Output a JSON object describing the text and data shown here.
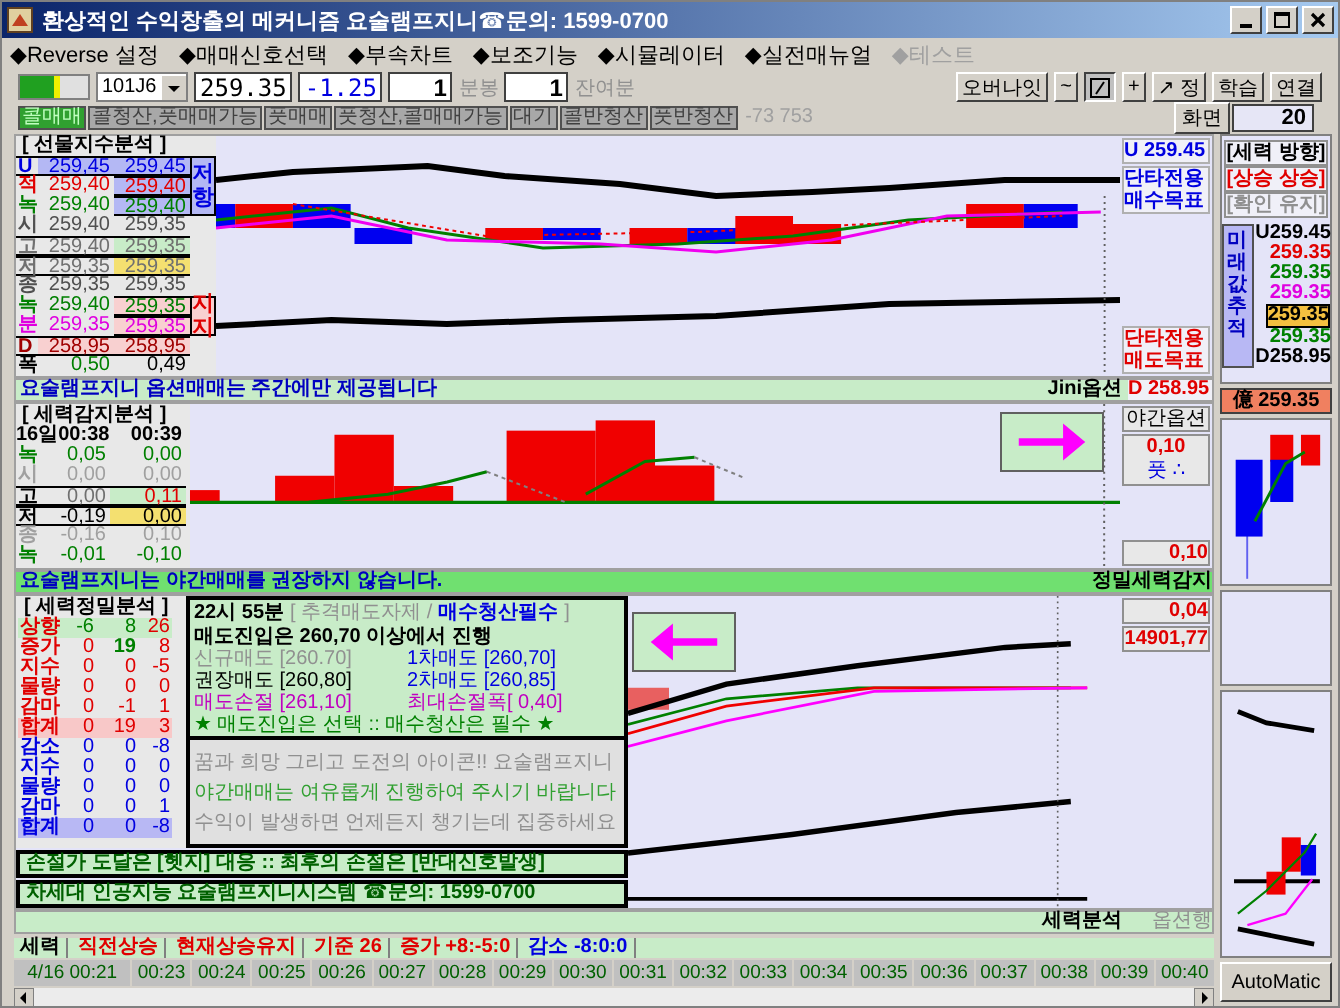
{
  "window": {
    "title": "환상적인 수익창출의 메커니즘 요술램프지니☎문의: 1599-0700"
  },
  "menu": [
    {
      "label": "◆Reverse 설정",
      "disabled": false
    },
    {
      "label": "◆매매신호선택",
      "disabled": false
    },
    {
      "label": "◆부속차트",
      "disabled": false
    },
    {
      "label": "◆보조기능",
      "disabled": false
    },
    {
      "label": "◆시뮬레이터",
      "disabled": false
    },
    {
      "label": "◆실전매뉴얼",
      "disabled": false
    },
    {
      "label": "◆테스트",
      "disabled": true
    }
  ],
  "toolbar": {
    "meter": {
      "level": 0.6
    },
    "symbol": "101J6",
    "price": "259.35",
    "change": "-1.25",
    "interval": "1",
    "interval_label": "분봉",
    "remaining": "1",
    "remaining_label": "잔여분",
    "tools": [
      {
        "kind": "text",
        "label": "오버나잇",
        "selected": false
      },
      {
        "kind": "text",
        "label": "~",
        "selected": false
      },
      {
        "kind": "line",
        "selected": true
      },
      {
        "kind": "text",
        "label": "+",
        "selected": false
      },
      {
        "kind": "text",
        "label": "↗ 정",
        "selected": false
      },
      {
        "kind": "text",
        "label": "학습",
        "selected": false
      },
      {
        "kind": "text",
        "label": "연결",
        "selected": false
      }
    ],
    "screen_label": "화면",
    "screen_value": "20"
  },
  "signals": [
    {
      "label": "콜매매",
      "selected": true
    },
    {
      "label": "콜청산,풋매매가능",
      "selected": false
    },
    {
      "label": "풋매매",
      "selected": false
    },
    {
      "label": "풋청산,콜매매가능",
      "selected": false
    },
    {
      "label": "대기",
      "selected": false
    },
    {
      "label": "콜반청산",
      "selected": false
    },
    {
      "label": "풋반청산",
      "selected": false
    }
  ],
  "signal_note": "-73 753",
  "futures_panel": {
    "title": "[ 선물지수분석 ]",
    "resist_label": "저항",
    "support_label": "지지",
    "rows": [
      {
        "label": "U",
        "values": [
          "259,45",
          "259,45"
        ],
        "color": "#0000e0",
        "kind": "upper"
      },
      {
        "label": "적",
        "values": [
          "259,40",
          "259,40"
        ],
        "color": "#e00000",
        "kind": "resist"
      },
      {
        "label": "녹",
        "values": [
          "259,40",
          "259,40"
        ],
        "color": "#008000",
        "kind": "resist"
      },
      {
        "label": "시",
        "values": [
          "259,40",
          "259,35"
        ],
        "color": "#505050",
        "kind": "plain"
      },
      {
        "label": "고",
        "values": [
          "259,40",
          "259,35"
        ],
        "color": "#707070",
        "kind": "high"
      },
      {
        "label": "저",
        "values": [
          "259,35",
          "259,35"
        ],
        "color": "#707070",
        "kind": "low"
      },
      {
        "label": "종",
        "values": [
          "259,35",
          "259,35"
        ],
        "color": "#505050",
        "kind": "plain"
      },
      {
        "label": "녹",
        "values": [
          "259,40",
          "259,35"
        ],
        "color": "#008000",
        "kind": "support"
      },
      {
        "label": "분",
        "values": [
          "259,35",
          "259,35"
        ],
        "color": "#e000e0",
        "kind": "support"
      },
      {
        "label": "D",
        "values": [
          "258,95",
          "258,95"
        ],
        "color": "#a00000",
        "kind": "lower"
      },
      {
        "label": "폭",
        "values": [
          "0,50",
          "0,49"
        ],
        "color": "#008000",
        "kind": "width"
      }
    ],
    "chart_labels": {
      "top_value": "U 259.45",
      "buy_target": [
        "단타전용",
        "매수목표"
      ],
      "sell_target": [
        "단타전용",
        "매도목표"
      ]
    },
    "footer": "요술램프지니 옵션매매는 주간에만 제공됩니다",
    "footer_tag": "Jini옵션",
    "footer_value": "D 258.95"
  },
  "detect_panel": {
    "title": "[ 세력감지분석 ]",
    "header": [
      "16일00:38",
      "00:39"
    ],
    "rows": [
      {
        "label": "녹",
        "values": [
          "0,05",
          "0,00"
        ],
        "color": "#008000",
        "kind": "plain"
      },
      {
        "label": "시",
        "values": [
          "0,00",
          "0,00"
        ],
        "color": "#a0a0a0",
        "kind": "plain"
      },
      {
        "label": "고",
        "values": [
          "0,00",
          "0,11"
        ],
        "color": "#707070",
        "kind": "high"
      },
      {
        "label": "저",
        "values": [
          "-0,19",
          "0,00"
        ],
        "color": "#000000",
        "kind": "low"
      },
      {
        "label": "종",
        "values": [
          "-0,16",
          "0,10"
        ],
        "color": "#a0a0a0",
        "kind": "plain"
      },
      {
        "label": "녹",
        "values": [
          "-0,01",
          "-0,10"
        ],
        "color": "#008000",
        "kind": "plain"
      }
    ],
    "night_label": "야간옵션",
    "night_value": "0,10",
    "put_label": "풋 ∴",
    "bottom_value": "0,10",
    "footer": "요술램프지니는 야간매매를 권장하지 않습니다.",
    "footer_tag": "정밀세력감지"
  },
  "precision_panel": {
    "title": "[ 세력정밀분석 ]",
    "rows": [
      {
        "label": "상향",
        "values": [
          "-6",
          "8",
          "26"
        ],
        "kind": "head"
      },
      {
        "label": "증가",
        "values": [
          "0",
          "19",
          "8"
        ],
        "kind": "peak"
      },
      {
        "label": "지수",
        "values": [
          "0",
          "0",
          "-5"
        ],
        "kind": "up"
      },
      {
        "label": "물량",
        "values": [
          "0",
          "0",
          "0"
        ],
        "kind": "up"
      },
      {
        "label": "감마",
        "values": [
          "0",
          "-1",
          "1"
        ],
        "kind": "up"
      },
      {
        "label": "합계",
        "values": [
          "0",
          "19",
          "3"
        ],
        "kind": "up-total"
      },
      {
        "label": "감소",
        "values": [
          "0",
          "0",
          "-8"
        ],
        "kind": "down"
      },
      {
        "label": "지수",
        "values": [
          "0",
          "0",
          "0"
        ],
        "kind": "down"
      },
      {
        "label": "물량",
        "values": [
          "0",
          "0",
          "0"
        ],
        "kind": "down"
      },
      {
        "label": "감마",
        "values": [
          "0",
          "0",
          "1"
        ],
        "kind": "down"
      },
      {
        "label": "합계",
        "values": [
          "0",
          "0",
          "-8"
        ],
        "kind": "down-total"
      }
    ],
    "message": {
      "time": "22시 55분",
      "advice": "[ 추격매도자제 /",
      "advice_strong": "매수청산필수",
      "advice_end": "]",
      "entry": "매도진입은 260,70 이상에서 진행",
      "levels": [
        {
          "text": "신규매도 [260.70]",
          "color": "#909090"
        },
        {
          "text": "1차매도 [260,70]",
          "color": "#0000e0"
        },
        {
          "text": "권장매도 [260,80]",
          "color": "#000000"
        },
        {
          "text": "2차매도 [260,85]",
          "color": "#0000e0"
        },
        {
          "text": "매도손절 [261,10]",
          "color": "#c000c0"
        },
        {
          "text": "최대손절폭[ 0,40]",
          "color": "#c000c0"
        }
      ],
      "rule": "★ 매도진입은 선택 :: 매수청산은 필수 ★",
      "notes": [
        {
          "text": "꿈과 희망 그리고 도전의 아이콘!! 요술램프지니",
          "color": "#909090"
        },
        {
          "text": "야간매매는 여유롭게 진행하여 주시기 바랍니다",
          "color": "#30a030"
        },
        {
          "text": "수익이 발생하면 언제든지 챙기는데 집중하세요",
          "color": "#909090"
        }
      ]
    },
    "stop_notice": "손절가 도달은 [헷지] 대응 :: 최후의 손절은 [반대신호발생]",
    "contact_notice": "차세대 인공지능 요술램프지니시스템 ☎문의: 1599-0700",
    "ratio_value": "0,04",
    "index_value": "14901,77",
    "footer_tag": "세력분석",
    "footer_option": "옵션행"
  },
  "status": [
    {
      "text": "세력",
      "color": "#000000"
    },
    {
      "text": "직전상승",
      "color": "#e00000"
    },
    {
      "text": "현재상승유지",
      "color": "#e00000"
    },
    {
      "text": "기준 26",
      "color": "#e00000"
    },
    {
      "text": "증가 +8:-5:0",
      "color": "#e00000"
    },
    {
      "text": "감소 -8:0:0",
      "color": "#0000e0"
    }
  ],
  "times": [
    "4/16 00:21",
    "00:23",
    "00:24",
    "00:25",
    "00:26",
    "00:27",
    "00:28",
    "00:29",
    "00:30",
    "00:31",
    "00:32",
    "00:33",
    "00:34",
    "00:35",
    "00:36",
    "00:37",
    "00:38",
    "00:39",
    "00:40"
  ],
  "side": {
    "direction_title": "[세력 방향]",
    "direction": "[상승 상승]",
    "confirm": "[확인 유지]",
    "track_label": "미래값추적",
    "values": [
      {
        "text": "U259.45",
        "color": "#000000",
        "selected": false
      },
      {
        "text": "259.35",
        "color": "#e00000",
        "selected": false
      },
      {
        "text": "259.35",
        "color": "#008000",
        "selected": false
      },
      {
        "text": "259.35",
        "color": "#e000e0",
        "selected": false
      },
      {
        "text": "259.35",
        "color": "#000000",
        "selected": true
      },
      {
        "text": "259.35",
        "color": "#008000",
        "selected": false
      },
      {
        "text": "D258.95",
        "color": "#000000",
        "selected": false
      }
    ],
    "price_tag": "億 259.35",
    "auto_button": "AutoMatic"
  }
}
